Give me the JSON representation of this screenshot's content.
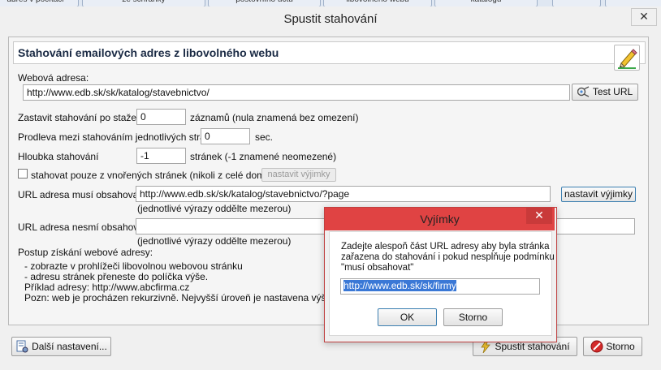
{
  "tabs": [
    {
      "label": "adres v počítači"
    },
    {
      "label": "ze schránky"
    },
    {
      "label": "poštovního účtu"
    },
    {
      "label": "libovolného webu"
    },
    {
      "label": "katalogu"
    },
    {
      "label": ""
    },
    {
      "label": ""
    }
  ],
  "window": {
    "title": "Spustit stahování",
    "close_glyph": "✕"
  },
  "section": {
    "title": "Stahování emailových adres z libovolného webu",
    "edit_icon": "pencil-icon"
  },
  "form": {
    "url_label": "Webová adresa:",
    "url_value": "http://www.edb.sk/sk/katalog/stavebnictvo/",
    "test_url_label": "Test URL",
    "stop_label": "Zastavit stahování po stažení",
    "stop_value": "0",
    "stop_suffix": "záznamů (nula znamená bez omezení)",
    "delay_label": "Prodleva mezi stahováním jednotlivých stránek",
    "delay_value": "0",
    "delay_suffix": "sec.",
    "depth_label": "Hloubka stahování",
    "depth_value": "-1",
    "depth_suffix": "stránek (-1 znamené neomezené)",
    "nested_label": "stahovat pouze z vnořených stránek (nikoli z celé domény)",
    "nested_checked": false,
    "nested_exceptions_label": "nastavit výjimky",
    "must_label": "URL adresa musí obsahovat:",
    "must_value": "http://www.edb.sk/sk/katalog/stavebnictvo/?page",
    "must_exceptions_label": "nastavit výjimky",
    "must_hint": "(jednotlivé výrazy oddělte mezerou)",
    "mustnot_label": "URL adresa nesmí obsahovat:",
    "mustnot_value": "",
    "mustnot_hint": "(jednotlivé výrazy oddělte mezerou)"
  },
  "instructions": {
    "heading": "Postup získání webové adresy:",
    "lines": [
      "- zobrazte v prohlížeči libovolnou webovou stránku",
      "- adresu stránek přeneste do políčka výše.",
      "Příklad adresy: http://www.abcfirma.cz",
      "Pozn: web je procházen rekurzivně. Nejvyšší úroveň je nastavena výše uvede"
    ]
  },
  "footer": {
    "more_settings_label": "Další nastavení...",
    "start_label": "Spustit stahování",
    "cancel_label": "Storno"
  },
  "dialog": {
    "title": "Vyjímky",
    "close_glyph": "✕",
    "message_lines": [
      "Zadejte alespoň část URL adresy aby byla stránka",
      "zařazena do stahování i pokud nesplňuje podmínku",
      "\"musí obsahovat\""
    ],
    "input_value": "http://www.edb.sk/sk/firmy",
    "ok_label": "OK",
    "cancel_label": "Storno"
  },
  "colors": {
    "dialog_title_bar": "#e04343",
    "selection": "#3a78d6",
    "header_text": "#1a2a44"
  }
}
